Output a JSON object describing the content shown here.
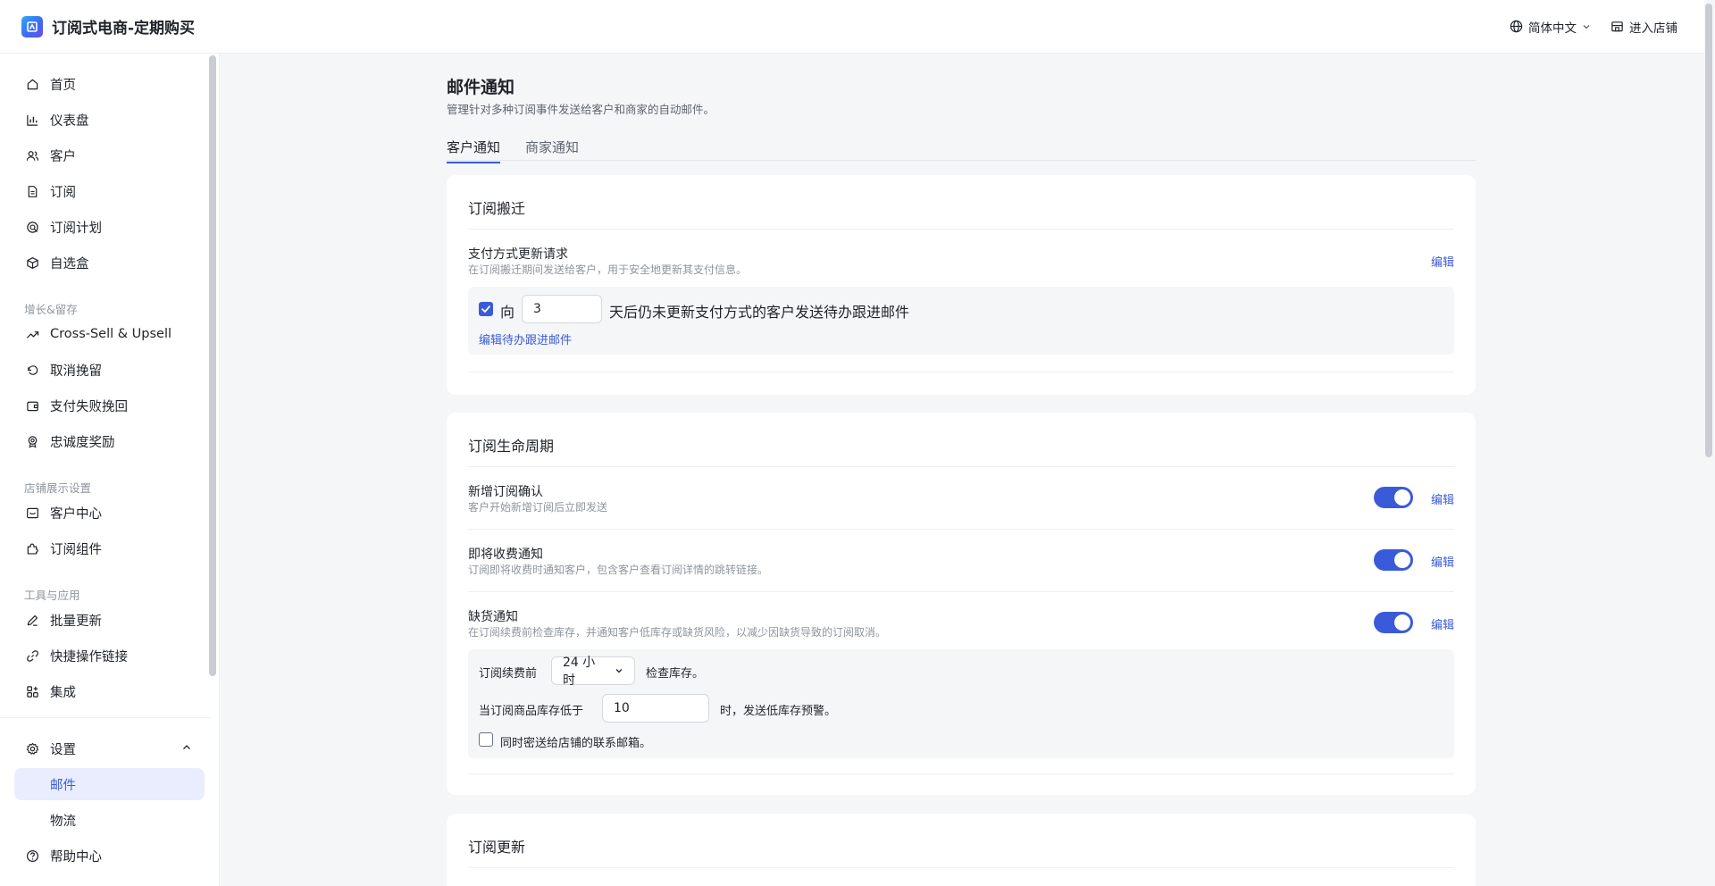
{
  "app": {
    "title": "订阅式电商-定期购买"
  },
  "topbar": {
    "language": "简体中文",
    "enter_store": "进入店铺"
  },
  "sidebar": {
    "items": {
      "home": "首页",
      "dashboard": "仪表盘",
      "customers": "客户",
      "subscriptions": "订阅",
      "plans": "订阅计划",
      "box": "自选盒",
      "cross_sell": "Cross-Sell & Upsell",
      "cancel": "取消挽留",
      "dunning": "支付失败挽回",
      "loyalty": "忠诚度奖励",
      "customer_portal": "客户中心",
      "widget": "订阅组件",
      "bulk_update": "批量更新",
      "quick_links": "快捷操作链接",
      "integrations": "集成",
      "settings": "设置",
      "email": "邮件",
      "logistics": "物流",
      "help": "帮助中心"
    },
    "sections": {
      "growth": "增长&留存",
      "storefront": "店铺展示设置",
      "tools": "工具与应用"
    }
  },
  "page": {
    "title": "邮件通知",
    "subtitle": "管理针对多种订阅事件发送给客户和商家的自动邮件。",
    "tabs": [
      "客户通知",
      "商家通知"
    ]
  },
  "migration": {
    "title": "订阅搬迁",
    "item_title": "支付方式更新请求",
    "item_desc": "在订阅搬迁期间发送给客户，用于安全地更新其支付信息。",
    "edit": "编辑",
    "followup_prefix": "向",
    "followup_days": "3",
    "followup_suffix": "天后仍未更新支付方式的客户发送待办跟进邮件",
    "followup_link": "编辑待办跟进邮件"
  },
  "lifecycle": {
    "title": "订阅生命周期",
    "items": [
      {
        "title": "新增订阅确认",
        "desc": "客户开始新增订阅后立即发送",
        "enabled": true
      },
      {
        "title": "即将收费通知",
        "desc": "订阅即将收费时通知客户，包含客户查看订阅详情的跳转链接。",
        "enabled": true
      },
      {
        "title": "缺货通知",
        "desc": "在订阅续费前检查库存，并通知客户低库存或缺货风险，以减少因缺货导致的订阅取消。",
        "enabled": true
      }
    ],
    "edit": "编辑",
    "stock": {
      "before_label": "订阅续费前",
      "before_value": "24 小时",
      "check_label": "检查库存。",
      "threshold_prefix": "当订阅商品库存低于",
      "threshold_value": "10",
      "threshold_suffix": "时，发送低库存预警。",
      "bcc_label": "同时密送给店铺的联系邮箱。",
      "bcc_checked": false
    }
  },
  "renewal": {
    "title": "订阅更新"
  },
  "colors": {
    "accent": "#3a5bd9",
    "active_bg": "#e9edfd",
    "page_bg": "#f5f6f8"
  }
}
